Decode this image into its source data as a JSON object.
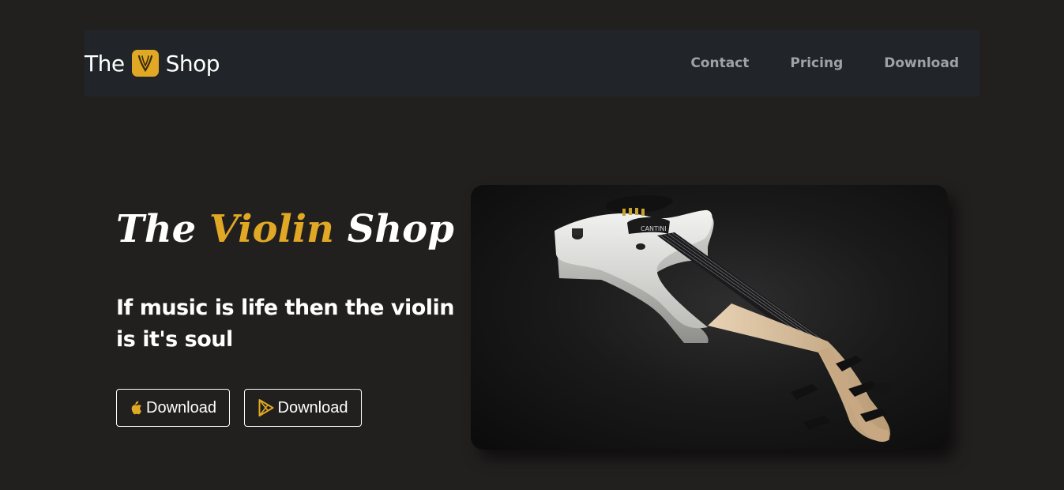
{
  "navbar": {
    "brand_prefix": "The",
    "brand_suffix": "Shop",
    "logo_icon": "violin-v-logo-icon",
    "links": [
      {
        "label": "Contact"
      },
      {
        "label": "Pricing"
      },
      {
        "label": "Download"
      }
    ]
  },
  "hero": {
    "title_word1": "The",
    "title_word2": "Violin",
    "title_word3": "Shop",
    "subtitle": "If music is life then the violin is it's soul",
    "buttons": [
      {
        "label": "Download",
        "icon": "apple-icon"
      },
      {
        "label": "Download",
        "icon": "google-play-icon"
      }
    ],
    "image_label": "CANTINI"
  },
  "colors": {
    "background": "#221f1f",
    "navbar": "#212428",
    "accent": "#e0a824",
    "nav_link": "#9ea3a8",
    "text": "#ffffff"
  }
}
